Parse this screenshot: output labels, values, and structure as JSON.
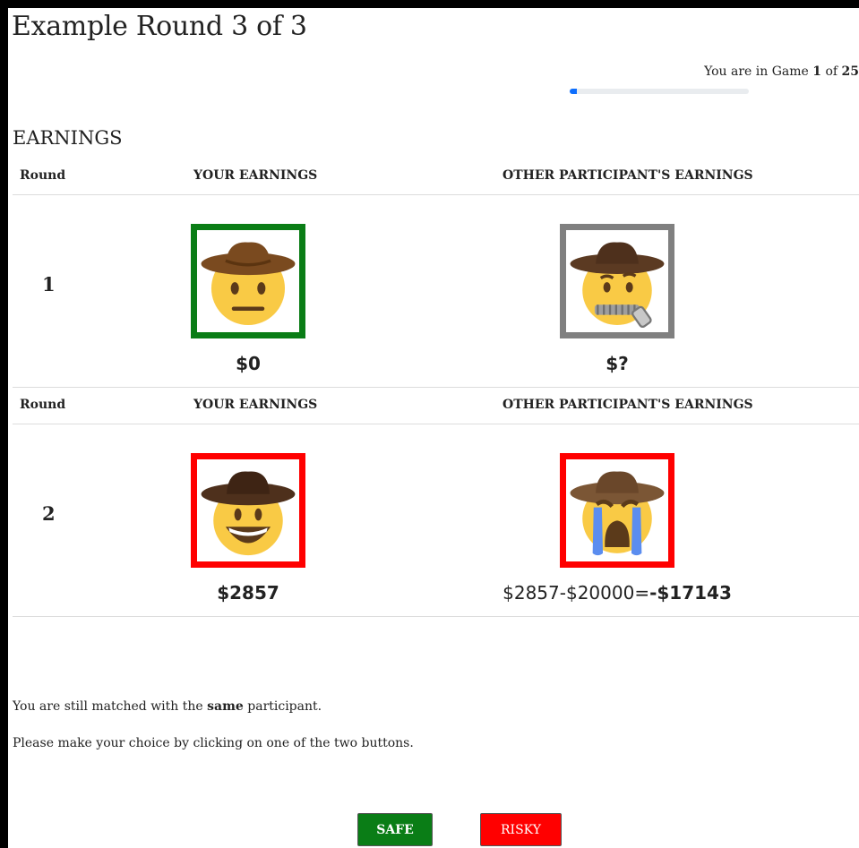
{
  "page": {
    "title": "Example Round 3 of 3",
    "progress": {
      "prefix": "You are in Game ",
      "current": "1",
      "middle": " of ",
      "total": "25",
      "fraction": 0.04
    },
    "section_title": "EARNINGS"
  },
  "headers": {
    "round": "Round",
    "yours": "YOUR EARNINGS",
    "other": "OTHER PARTICIPANT'S EARNINGS"
  },
  "rows": [
    {
      "round": "1",
      "your_face": "cowboy-neutral-face-icon",
      "your_border": "#0a7d16",
      "your_earnings": "$0",
      "other_face": "cowboy-zipper-mouth-face-icon",
      "other_border": "#808080",
      "other_earnings": "$?"
    },
    {
      "round": "2",
      "your_face": "cowboy-grinning-face-icon",
      "your_border": "#ff0000",
      "your_earnings": "$2857",
      "other_face": "cowboy-crying-face-icon",
      "other_border": "#ff0000",
      "other_earnings_expr": "$2857-$20000=",
      "other_earnings_result": "-$17143"
    }
  ],
  "info": {
    "matched_prefix": "You are still matched with the ",
    "matched_bold": "same",
    "matched_suffix": " participant.",
    "instruction": "Please make your choice by clicking on one of the two buttons."
  },
  "buttons": {
    "safe": "SAFE",
    "risky": "RISKY",
    "safe_color": "#0a7d16",
    "risky_color": "#ff0000"
  }
}
